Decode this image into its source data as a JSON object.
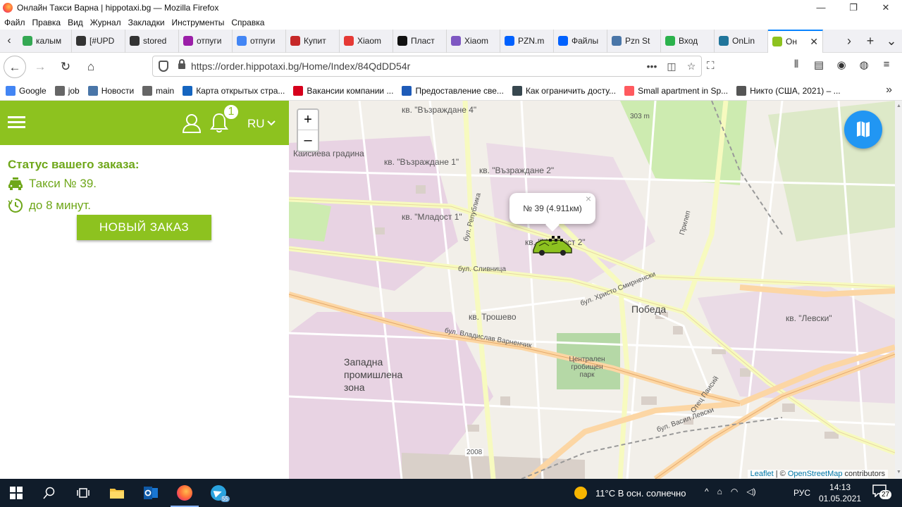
{
  "window": {
    "title": "Онлайн Такси Варна | hippotaxi.bg — Mozilla Firefox"
  },
  "menubar": [
    "Файл",
    "Правка",
    "Вид",
    "Журнал",
    "Закладки",
    "Инструменты",
    "Справка"
  ],
  "tabs": [
    {
      "label": "калым",
      "icon": "maps-icon",
      "color": "#34a853"
    },
    {
      "label": "[#UPD",
      "icon": "ubuntu-icon",
      "color": "#333333"
    },
    {
      "label": "stored",
      "icon": "ubuntu-icon",
      "color": "#333333"
    },
    {
      "label": "отпуги",
      "icon": "wildberries-icon",
      "color": "#9b1fa8"
    },
    {
      "label": "отпуги",
      "icon": "google-icon",
      "color": "#4285f4"
    },
    {
      "label": "Купит",
      "icon": "music-icon",
      "color": "#c62828"
    },
    {
      "label": "Xiaom",
      "icon": "yandex-icon",
      "color": "#e53935"
    },
    {
      "label": "Пласт",
      "icon": "mi-icon",
      "color": "#111111"
    },
    {
      "label": "Xiaom",
      "icon": "xiaomi-icon",
      "color": "#7e57c2"
    },
    {
      "label": "PZN.m",
      "icon": "dropbox-icon",
      "color": "#0061fe"
    },
    {
      "label": "Файлы",
      "icon": "dropbox-icon",
      "color": "#0061fe"
    },
    {
      "label": "Pzn St",
      "icon": "vk-icon",
      "color": "#4a76a8"
    },
    {
      "label": "Вход",
      "icon": "feedly-icon",
      "color": "#2bb24c"
    },
    {
      "label": "OnLin",
      "icon": "wordpress-icon",
      "color": "#21759b"
    },
    {
      "label": "Он",
      "icon": "hippotaxi-icon",
      "color": "#8dc21f",
      "active": true
    }
  ],
  "navbar": {
    "url_prefix": "https://order.",
    "url_domain": "hippotaxi.bg",
    "url_path": "/Home/Index/84QdDD54r",
    "url": "https://order.hippotaxi.bg/Home/Index/84QdDD54r"
  },
  "bookmarks": [
    {
      "label": "Google",
      "icon": "google-icon",
      "color": "#4285f4"
    },
    {
      "label": "job",
      "icon": "folder-icon",
      "color": "#666666"
    },
    {
      "label": "Новости",
      "icon": "vk-icon",
      "color": "#4a76a8"
    },
    {
      "label": "main",
      "icon": "folder-icon",
      "color": "#666666"
    },
    {
      "label": "Карта открытых стра...",
      "icon": "c-icon",
      "color": "#1565c0"
    },
    {
      "label": "Вакансии компании ...",
      "icon": "hh-icon",
      "color": "#d6001c"
    },
    {
      "label": "Предоставление све...",
      "icon": "flag-icon",
      "color": "#1e5bb8"
    },
    {
      "label": "Как ограничить досту...",
      "icon": "page-icon",
      "color": "#37474f"
    },
    {
      "label": "Small apartment in Sp...",
      "icon": "airbnb-icon",
      "color": "#ff5a5f"
    },
    {
      "label": "Никто (США, 2021) – ...",
      "icon": "globe-icon",
      "color": "#555555"
    }
  ],
  "app": {
    "brand_color": "#8dc21f",
    "text_color": "#6fa71a",
    "notifications_count": "1",
    "language": "RU",
    "status_title": "Статус вашего заказа:",
    "taxi_text": "Такси № 39.",
    "eta_text": "до 8 минут.",
    "new_order_label": "НОВЫЙ ЗАКАЗ"
  },
  "map": {
    "zoom_in": "+",
    "zoom_out": "–",
    "popup_text": "№ 39 (4.911км)",
    "popup_close": "×",
    "labels": [
      {
        "text": "кв. \"Възраждане 4\"",
        "kind": "district"
      },
      {
        "text": "кв. \"Възраждане 1\"",
        "kind": "district"
      },
      {
        "text": "кв. \"Възраждане 2\"",
        "kind": "district"
      },
      {
        "text": "кв. \"Младост 1\"",
        "kind": "district"
      },
      {
        "text": "кв. \"Младост 2\"",
        "kind": "district"
      },
      {
        "text": "Кайсиева градина",
        "kind": "district"
      },
      {
        "text": "бул. Сливница",
        "kind": "street"
      },
      {
        "text": "бул. Христо Смирненски",
        "kind": "street"
      },
      {
        "text": "Победа",
        "kind": "district"
      },
      {
        "text": "кв. Трошево",
        "kind": "district"
      },
      {
        "text": "бул. Владислав Варненчик",
        "kind": "street"
      },
      {
        "text": "Западна промишлена зона",
        "kind": "district"
      },
      {
        "text": "Централен гробищен парк",
        "kind": "park"
      },
      {
        "text": "кв. \"Левски\"",
        "kind": "district"
      },
      {
        "text": "бул. Васил Левски",
        "kind": "street"
      },
      {
        "text": "бул. Република",
        "kind": "street"
      },
      {
        "text": "Отец Паисий",
        "kind": "street"
      },
      {
        "text": "Прилеп",
        "kind": "street"
      },
      {
        "text": "2008",
        "kind": "road-number"
      },
      {
        "text": "303 m",
        "kind": "elevation"
      }
    ],
    "attribution_leaflet": "Leaflet",
    "attribution_sep": " | © ",
    "attribution_osm": "OpenStreetMap",
    "attribution_tail": " contributors"
  },
  "taskbar": {
    "weather": "11°C  В осн. солнечно",
    "language": "РУС",
    "time": "14:13",
    "date": "01.05.2021",
    "notifications": "27",
    "telegram_badge": "55"
  }
}
